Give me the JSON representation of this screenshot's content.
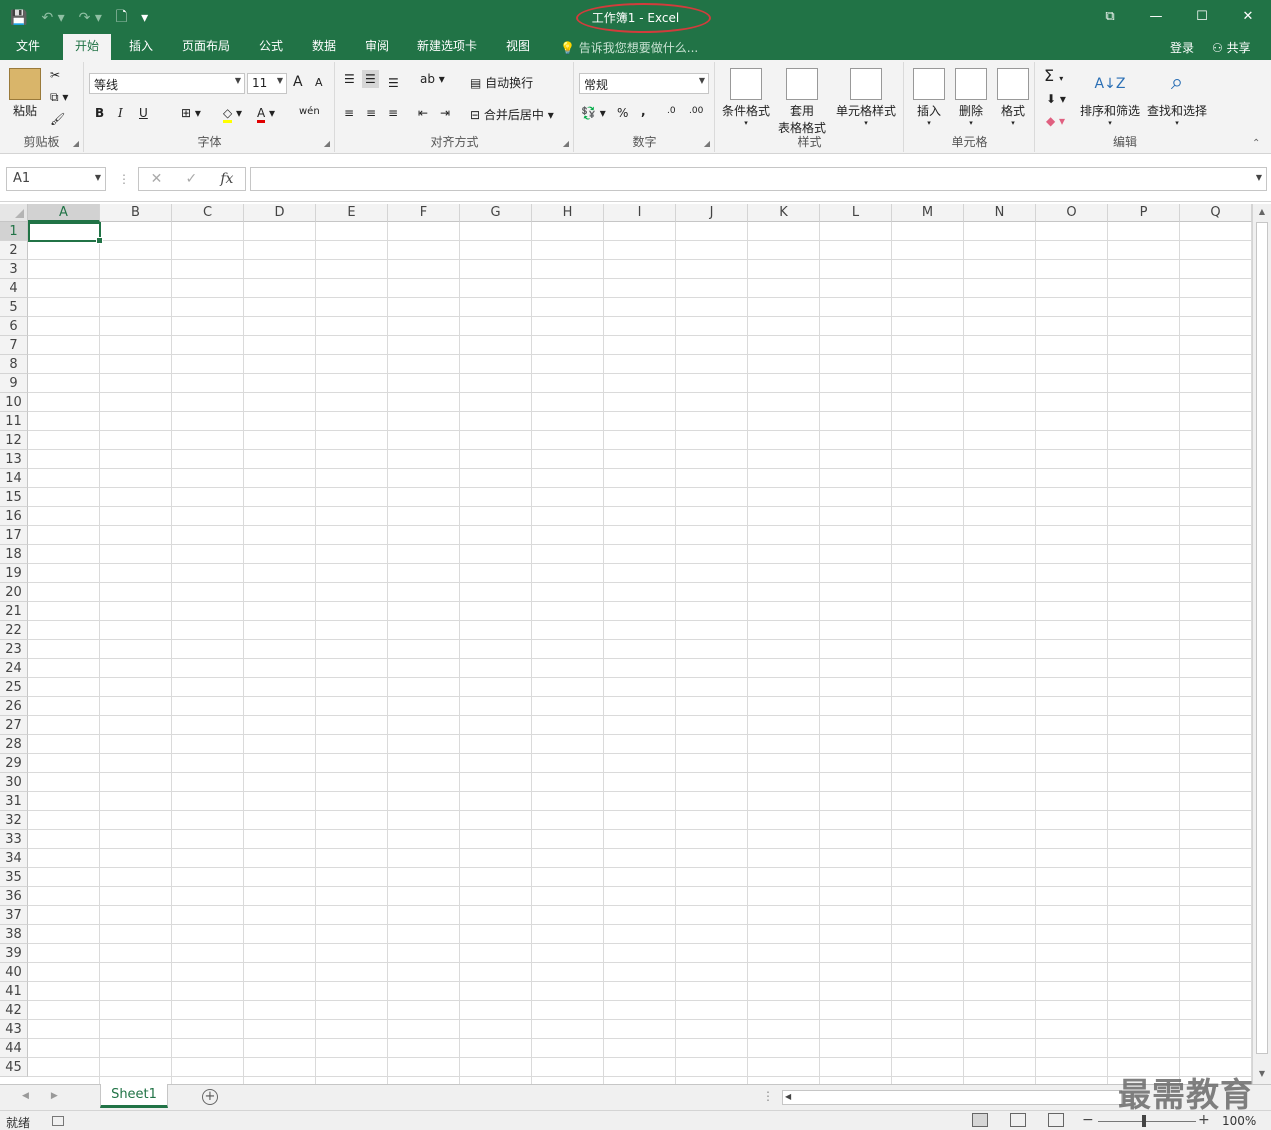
{
  "window": {
    "title": "工作簿1 - Excel",
    "controls": {
      "ribbon_display": "⧉",
      "minimize": "—",
      "maximize": "☐",
      "close": "✕"
    }
  },
  "quick_access": {
    "save": "💾",
    "undo": "↶ ▾",
    "redo": "↷ ▾",
    "new": "🗋",
    "customize": "▾"
  },
  "tabs": [
    "文件",
    "开始",
    "插入",
    "页面布局",
    "公式",
    "数据",
    "审阅",
    "新建选项卡",
    "视图"
  ],
  "active_tab": "开始",
  "tell_me": "告诉我您想要做什么...",
  "account": {
    "login": "登录",
    "share": "共享"
  },
  "ribbon": {
    "clipboard": {
      "paste": "粘贴",
      "label": "剪贴板"
    },
    "font": {
      "name": "等线",
      "size": "11",
      "label": "字体",
      "bold": "B",
      "italic": "I",
      "underline": "U",
      "grow": "A",
      "shrink": "A",
      "font_color_glyph": "A",
      "phonetic": "wén"
    },
    "alignment": {
      "wrap": "自动换行",
      "merge": "合并后居中",
      "label": "对齐方式"
    },
    "number": {
      "format": "常规",
      "percent": "%",
      "comma": ",",
      "label": "数字",
      "inc_decimal": ".0",
      "dec_decimal": ".00"
    },
    "styles": {
      "conditional": "条件格式",
      "table_1": "套用",
      "table_2": "表格格式",
      "cell_styles": "单元格样式",
      "label": "样式"
    },
    "cells": {
      "insert": "插入",
      "delete": "删除",
      "format": "格式",
      "label": "单元格"
    },
    "editing": {
      "sort": "排序和筛选",
      "find": "查找和选择",
      "label": "编辑",
      "sum": "Σ"
    }
  },
  "formula_bar": {
    "name_box": "A1",
    "cancel": "✕",
    "enter": "✓",
    "fx": "fx",
    "value": ""
  },
  "columns": [
    "A",
    "B",
    "C",
    "D",
    "E",
    "F",
    "G",
    "H",
    "I",
    "J",
    "K",
    "L",
    "M",
    "N",
    "O",
    "P",
    "Q"
  ],
  "rows": [
    "1",
    "2",
    "3",
    "4",
    "5",
    "6",
    "7",
    "8",
    "9",
    "10",
    "11",
    "12",
    "13",
    "14",
    "15",
    "16",
    "17",
    "18",
    "19",
    "20",
    "21",
    "22",
    "23",
    "24",
    "25",
    "26",
    "27",
    "28",
    "29",
    "30",
    "31",
    "32",
    "33",
    "34",
    "35",
    "36",
    "37",
    "38",
    "39",
    "40",
    "41",
    "42",
    "43",
    "44",
    "45"
  ],
  "active_cell": "A1",
  "sheets": [
    "Sheet1"
  ],
  "add_sheet": "+",
  "status": {
    "mode": "就绪",
    "zoom": "100%",
    "zoom_minus": "−",
    "zoom_plus": "+"
  },
  "watermark": "最需教育",
  "colors": {
    "accent": "#217346",
    "title_highlight": "#d23c3c"
  }
}
